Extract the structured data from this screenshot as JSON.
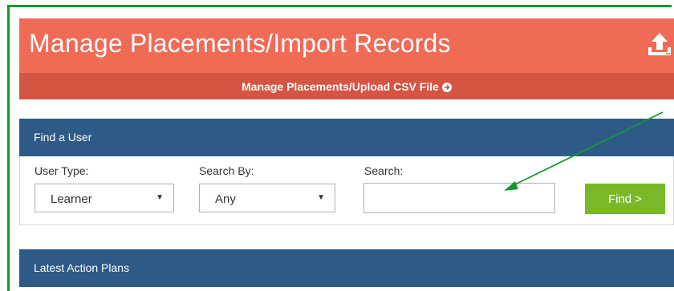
{
  "header": {
    "title": "Manage Placements/Import Records",
    "upload_link": "Manage Placements/Upload CSV File"
  },
  "find_user": {
    "heading": "Find a User",
    "user_type_label": "User Type:",
    "user_type_value": "Learner",
    "search_by_label": "Search By:",
    "search_by_value": "Any",
    "search_label": "Search:",
    "search_value": "",
    "find_button": "Find >"
  },
  "latest": {
    "heading": "Latest Action Plans"
  },
  "icons": {
    "upload": "upload-icon",
    "link_arrow": "arrow-circle-right-icon",
    "dropdown": "caret-down-icon"
  },
  "colors": {
    "header": "#f06b56",
    "header_sub": "#d55442",
    "panel_head": "#2e5a87",
    "find_button": "#78b829",
    "annotation": "#119a2c"
  }
}
